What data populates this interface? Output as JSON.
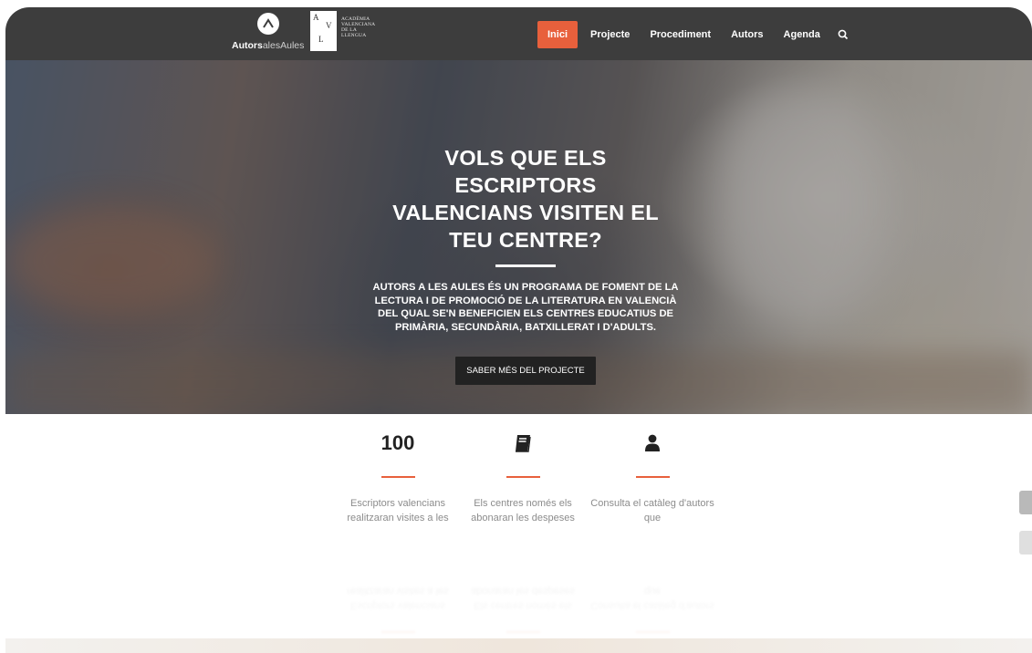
{
  "brand": {
    "logo_bold": "Autors",
    "logo_light": "alesAules",
    "avl_letters": [
      "A",
      "V",
      "L"
    ],
    "avl_lines": [
      "ACADÈMIA",
      "VALENCIANA",
      "DE LA",
      "LLENGUA"
    ]
  },
  "nav": {
    "items": [
      {
        "label": "Inici",
        "active": true
      },
      {
        "label": "Projecte"
      },
      {
        "label": "Procediment"
      },
      {
        "label": "Autors"
      },
      {
        "label": "Agenda"
      }
    ],
    "search_icon": "search-icon"
  },
  "hero": {
    "title_lines": [
      "VOLS QUE ELS",
      "ESCRIPTORS",
      "VALENCIANS VISITEN EL",
      "TEU CENTRE?"
    ],
    "text": "AUTORS A LES AULES ÉS UN PROGRAMA DE FOMENT DE LA LECTURA I DE PROMOCIÓ DE LA LITERATURA EN VALENCIÀ DEL QUAL SE'N BENEFICIEN ELS CENTRES EDUCATIUS DE PRIMÀRIA, SECUNDÀRIA, BATXILLERAT I D'ADULTS.",
    "button": "SABER MÉS DEL PROJECTE"
  },
  "features": [
    {
      "number": "100",
      "desc": "Escriptors valencians realitzaran visites a les"
    },
    {
      "icon": "book-icon",
      "desc": "Els centres només els abonaran les despeses"
    },
    {
      "icon": "user-icon",
      "desc": "Consulta el catàleg d'autors que"
    }
  ],
  "colors": {
    "accent": "#e8603c",
    "topbar": "#3d3d3d"
  }
}
